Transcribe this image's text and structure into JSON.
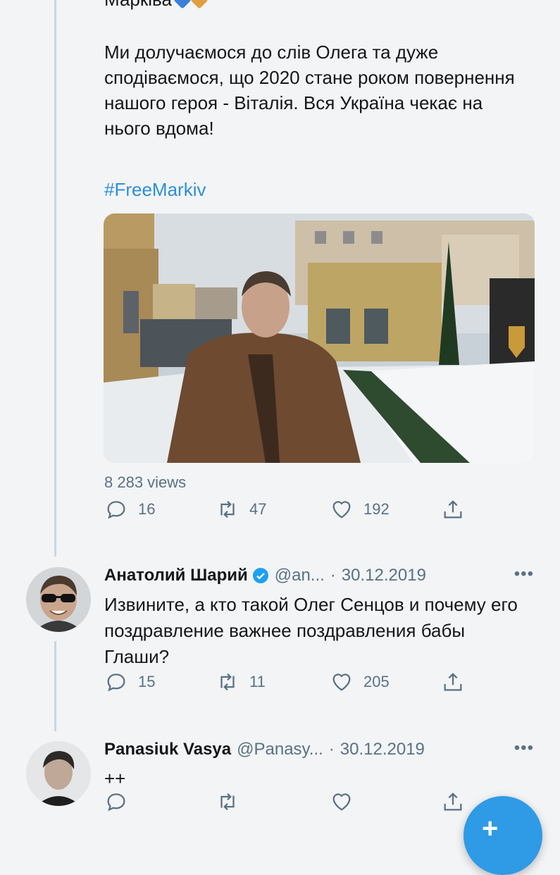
{
  "tweet": {
    "author_partial": "Марківа",
    "text": "Ми долучаємося до слів Олега та дуже сподіваємося, що 2020 стане роком повернення нашого героя - Віталія. Вся Україна чекає на нього вдома!",
    "hashtag": "#FreeMarkiv",
    "video_views": "8 283 views",
    "replies": "16",
    "retweets": "47",
    "likes": "192"
  },
  "replies": [
    {
      "name": "Анатолий Шарий",
      "verified": true,
      "handle": "@an...",
      "separator": "·",
      "date": "30.12.2019",
      "text": "Извините, а кто такой Олег Сенцов и почему его поздравление важнее поздравления бабы Глаши?",
      "replies": "15",
      "retweets": "11",
      "likes": "205"
    },
    {
      "name": "Panasiuk Vasya",
      "handle": "@Panasy...",
      "separator": "·",
      "date": "30.12.2019",
      "text": "++",
      "replies": "",
      "retweets": "",
      "likes": ""
    }
  ],
  "more_label": "•••",
  "fab_label": "+",
  "colors": {
    "accent": "#1da1f2",
    "muted": "#5b7083",
    "thread_line": "#cdd5dc"
  },
  "icons": [
    "reply-icon",
    "retweet-icon",
    "like-icon",
    "share-icon",
    "verified-badge-icon",
    "compose-icon"
  ]
}
